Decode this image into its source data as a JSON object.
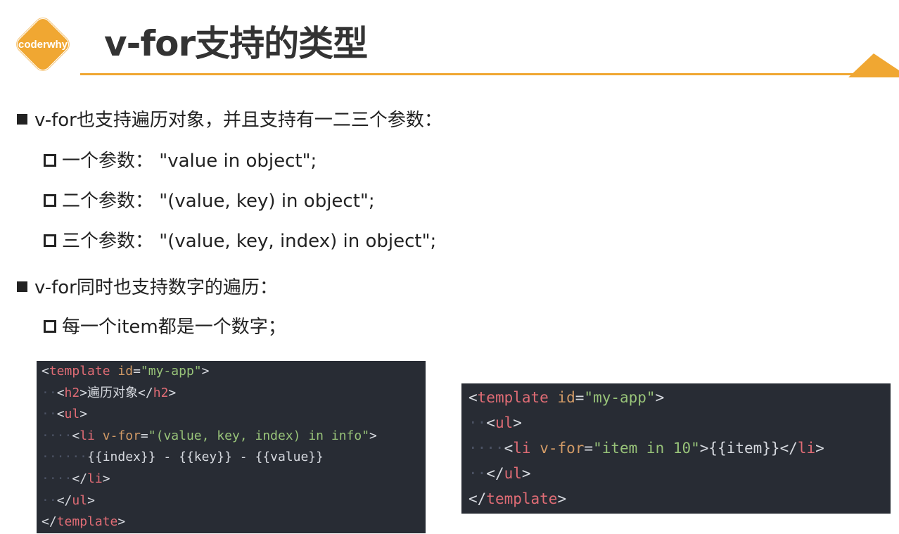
{
  "header": {
    "logo_text": "coderwhy",
    "title": "v-for支持的类型",
    "accent_color": "#f0a732",
    "logo_color": "#f0a732"
  },
  "bullets": [
    {
      "level": 1,
      "text": "v-for也支持遍历对象，并且支持有一二三个参数："
    },
    {
      "level": 2,
      "text": "一个参数： \"value in object\";"
    },
    {
      "level": 2,
      "text": "二个参数： \"(value, key) in object\";"
    },
    {
      "level": 2,
      "text": "三个参数： \"(value, key, index) in object\";"
    },
    {
      "level": 1,
      "text": "v-for同时也支持数字的遍历："
    },
    {
      "level": 2,
      "text": "每一个item都是一个数字；"
    }
  ],
  "code_block_1": {
    "background": "#282c34",
    "lines": [
      [
        {
          "t": "<",
          "c": "pun"
        },
        {
          "t": "template",
          "c": "tag"
        },
        {
          "t": " ",
          "c": "txt"
        },
        {
          "t": "id",
          "c": "attr"
        },
        {
          "t": "=",
          "c": "pun"
        },
        {
          "t": "\"my-app\"",
          "c": "str"
        },
        {
          "t": ">",
          "c": "pun"
        }
      ],
      [
        {
          "t": "··",
          "c": "ind"
        },
        {
          "t": "<",
          "c": "pun"
        },
        {
          "t": "h2",
          "c": "tag"
        },
        {
          "t": ">遍历对象</",
          "c": "txt"
        },
        {
          "t": "h2",
          "c": "tag"
        },
        {
          "t": ">",
          "c": "pun"
        }
      ],
      [
        {
          "t": "··",
          "c": "ind"
        },
        {
          "t": "<",
          "c": "pun"
        },
        {
          "t": "ul",
          "c": "tag"
        },
        {
          "t": ">",
          "c": "pun"
        }
      ],
      [
        {
          "t": "····",
          "c": "ind"
        },
        {
          "t": "<",
          "c": "pun"
        },
        {
          "t": "li",
          "c": "tag"
        },
        {
          "t": " ",
          "c": "txt"
        },
        {
          "t": "v-for",
          "c": "attr"
        },
        {
          "t": "=",
          "c": "pun"
        },
        {
          "t": "\"(value, key, index) in info\"",
          "c": "str"
        },
        {
          "t": ">",
          "c": "pun"
        }
      ],
      [
        {
          "t": "······",
          "c": "ind"
        },
        {
          "t": "{{index}} - {{key}} - {{value}}",
          "c": "txt"
        }
      ],
      [
        {
          "t": "····",
          "c": "ind"
        },
        {
          "t": "</",
          "c": "pun"
        },
        {
          "t": "li",
          "c": "tag"
        },
        {
          "t": ">",
          "c": "pun"
        }
      ],
      [
        {
          "t": "··",
          "c": "ind"
        },
        {
          "t": "</",
          "c": "pun"
        },
        {
          "t": "ul",
          "c": "tag"
        },
        {
          "t": ">",
          "c": "pun"
        }
      ],
      [
        {
          "t": "</",
          "c": "pun"
        },
        {
          "t": "template",
          "c": "tag"
        },
        {
          "t": ">",
          "c": "pun"
        }
      ]
    ]
  },
  "code_block_2": {
    "background": "#282c34",
    "lines": [
      [
        {
          "t": "<",
          "c": "pun"
        },
        {
          "t": "template",
          "c": "tag"
        },
        {
          "t": " ",
          "c": "txt"
        },
        {
          "t": "id",
          "c": "attr"
        },
        {
          "t": "=",
          "c": "pun"
        },
        {
          "t": "\"my-app\"",
          "c": "str"
        },
        {
          "t": ">",
          "c": "pun"
        }
      ],
      [
        {
          "t": "··",
          "c": "ind"
        },
        {
          "t": "<",
          "c": "pun"
        },
        {
          "t": "ul",
          "c": "tag"
        },
        {
          "t": ">",
          "c": "pun"
        }
      ],
      [
        {
          "t": "····",
          "c": "ind"
        },
        {
          "t": "<",
          "c": "pun"
        },
        {
          "t": "li",
          "c": "tag"
        },
        {
          "t": " ",
          "c": "txt"
        },
        {
          "t": "v-for",
          "c": "attr"
        },
        {
          "t": "=",
          "c": "pun"
        },
        {
          "t": "\"item in 10\"",
          "c": "str"
        },
        {
          "t": ">{{item}}</",
          "c": "txt"
        },
        {
          "t": "li",
          "c": "tag"
        },
        {
          "t": ">",
          "c": "pun"
        }
      ],
      [
        {
          "t": "··",
          "c": "ind"
        },
        {
          "t": "</",
          "c": "pun"
        },
        {
          "t": "ul",
          "c": "tag"
        },
        {
          "t": ">",
          "c": "pun"
        }
      ],
      [
        {
          "t": "</",
          "c": "pun"
        },
        {
          "t": "template",
          "c": "tag"
        },
        {
          "t": ">",
          "c": "pun"
        }
      ]
    ]
  }
}
